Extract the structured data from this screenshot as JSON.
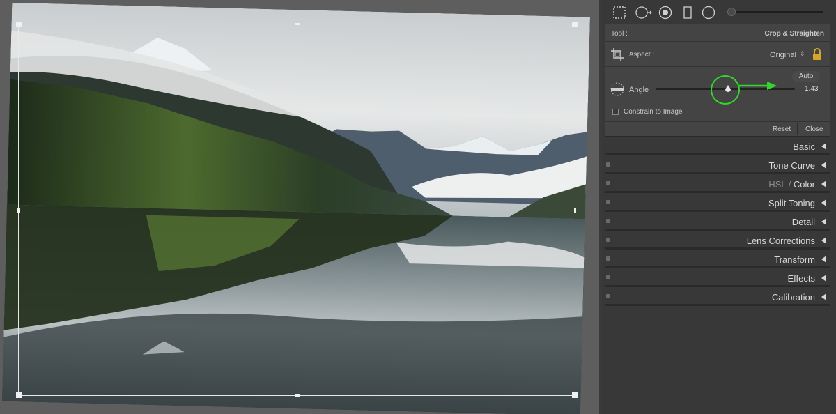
{
  "canvas": {
    "photo_subject": "mountain-lake-reflection"
  },
  "toolstrip": {
    "tools": [
      {
        "name": "crop-overlay-tool-icon"
      },
      {
        "name": "spot-removal-tool-icon"
      },
      {
        "name": "red-eye-tool-icon"
      },
      {
        "name": "graduated-filter-tool-icon"
      },
      {
        "name": "radial-filter-tool-icon"
      }
    ]
  },
  "crop": {
    "tool_label": "Tool :",
    "tool_name": "Crop & Straighten",
    "aspect_label": "Aspect :",
    "aspect_value": "Original",
    "auto_label": "Auto",
    "angle_label": "Angle",
    "angle_value": "1.43",
    "angle_fraction": 0.52,
    "constrain_label": "Constrain to Image",
    "constrain_checked": false,
    "reset_label": "Reset",
    "close_label": "Close"
  },
  "sections": [
    {
      "label": "Basic",
      "has_switch": false
    },
    {
      "label": "Tone Curve",
      "has_switch": true
    },
    {
      "label_dim": "HSL",
      "label_sep": " / ",
      "label": "Color",
      "has_switch": true
    },
    {
      "label": "Split Toning",
      "has_switch": true
    },
    {
      "label": "Detail",
      "has_switch": true
    },
    {
      "label": "Lens Corrections",
      "has_switch": true
    },
    {
      "label": "Transform",
      "has_switch": true
    },
    {
      "label": "Effects",
      "has_switch": true
    },
    {
      "label": "Calibration",
      "has_switch": true
    }
  ],
  "colors": {
    "highlight": "#30d82a",
    "panel_bg": "#383838",
    "lock_icon": "#d4a72c"
  }
}
